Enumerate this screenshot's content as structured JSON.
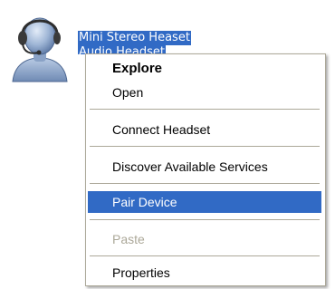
{
  "device": {
    "icon": "headset-icon",
    "label_line1": "Mini Stereo Heaset",
    "label_line2": "Audio Headset"
  },
  "context_menu": {
    "items": [
      {
        "label": "Explore",
        "bold": true,
        "highlighted": false,
        "disabled": false
      },
      {
        "label": "Open",
        "bold": false,
        "highlighted": false,
        "disabled": false
      },
      {
        "label": "Connect Headset",
        "bold": false,
        "highlighted": false,
        "disabled": false
      },
      {
        "label": "Discover Available Services",
        "bold": false,
        "highlighted": false,
        "disabled": false
      },
      {
        "label": "Pair Device",
        "bold": false,
        "highlighted": true,
        "disabled": false
      },
      {
        "label": "Paste",
        "bold": false,
        "highlighted": false,
        "disabled": true
      },
      {
        "label": "Properties",
        "bold": false,
        "highlighted": false,
        "disabled": false
      }
    ]
  },
  "colors": {
    "selection": "#316ac5",
    "menu_border": "#aca899",
    "disabled_text": "#aca899"
  }
}
